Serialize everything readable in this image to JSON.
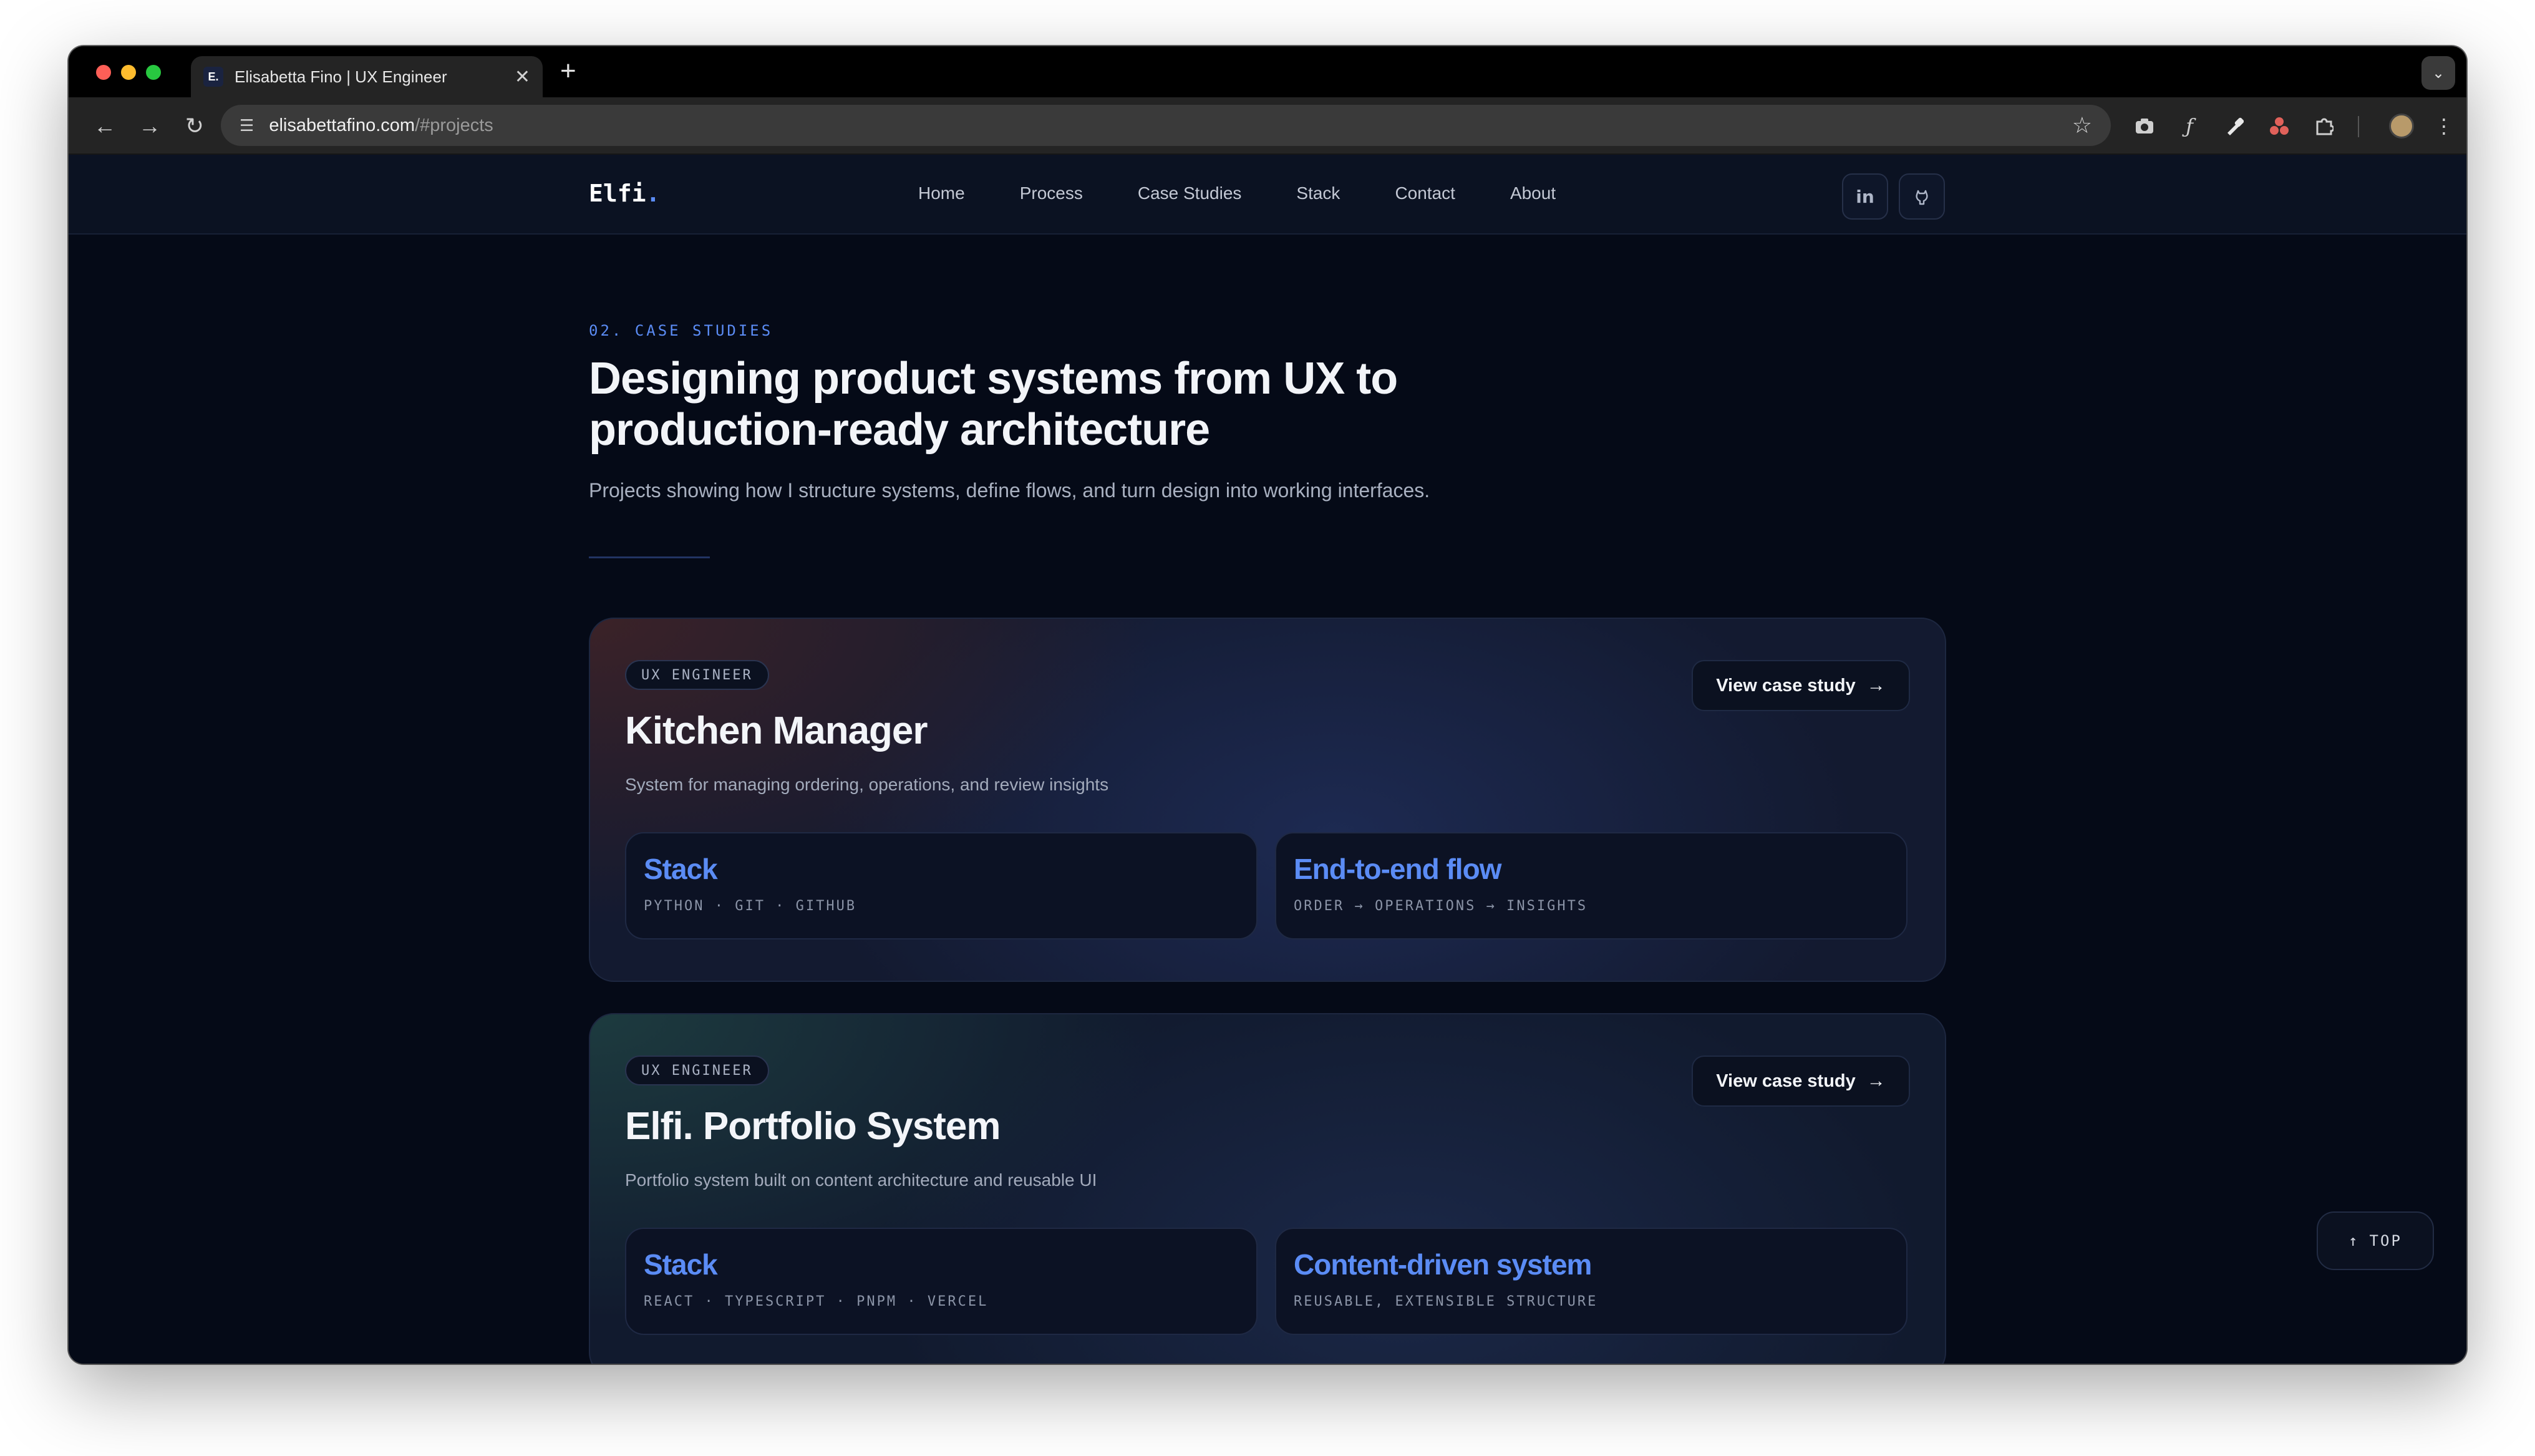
{
  "browser": {
    "tab_title": "Elisabetta Fino | UX Engineer",
    "favicon_letter": "E.",
    "tab_close": "✕",
    "new_tab": "+",
    "tab_menu": "⌄",
    "url_host": "elisabettafino.com",
    "url_path": "/#projects",
    "back": "←",
    "forward": "→",
    "reload": "↻",
    "site_settings": "☰",
    "bookmark": "☆",
    "menu": "⋮"
  },
  "site": {
    "logo": "Elfi",
    "logo_dot": ".",
    "nav": [
      "Home",
      "Process",
      "Case Studies",
      "Stack",
      "Contact",
      "About"
    ],
    "social": {
      "linkedin_glyph": "in",
      "github_glyph": "⌂"
    }
  },
  "section": {
    "eyebrow": "02. CASE STUDIES",
    "headline": "Designing product systems from UX to production-ready architecture",
    "intro": "Projects showing how I structure systems, define flows, and turn design into working interfaces."
  },
  "projects": [
    {
      "badge": "UX ENGINEER",
      "title": "Kitchen Manager",
      "description": "System for managing ordering, operations, and review insights",
      "cta": "View case study",
      "cta_arrow": "→",
      "tiles": [
        {
          "title": "Stack",
          "subtitle": "PYTHON · GIT · GITHUB"
        },
        {
          "title": "End-to-end flow",
          "subtitle": "ORDER → OPERATIONS → INSIGHTS"
        }
      ]
    },
    {
      "badge": "UX ENGINEER",
      "title": "Elfi. Portfolio System",
      "description": "Portfolio system built on content architecture and reusable UI",
      "cta": "View case study",
      "cta_arrow": "→",
      "tiles": [
        {
          "title": "Stack",
          "subtitle": "REACT · TYPESCRIPT · PNPM · VERCEL"
        },
        {
          "title": "Content-driven system",
          "subtitle": "REUSABLE, EXTENSIBLE STRUCTURE"
        }
      ]
    }
  ],
  "scroll_top": {
    "arrow": "↑",
    "label": "TOP"
  },
  "colors": {
    "accent": "#5b8cf5",
    "background": "#050a17",
    "header": "#0b1222"
  }
}
